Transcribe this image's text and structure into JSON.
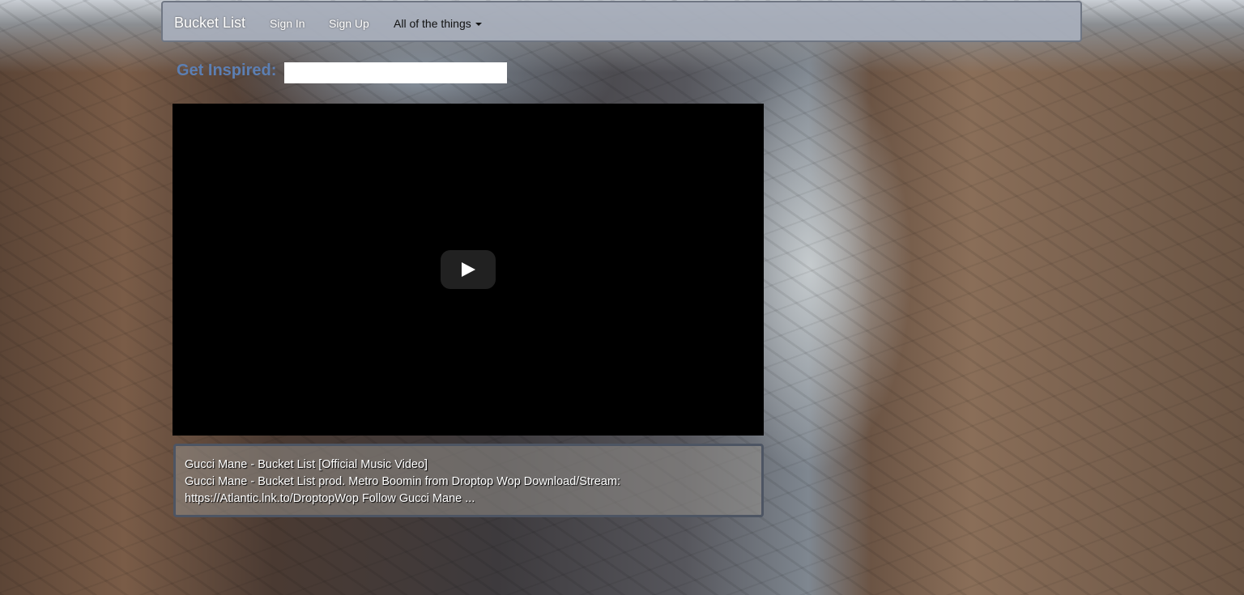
{
  "navbar": {
    "brand": "Bucket List",
    "sign_in": "Sign In",
    "sign_up": "Sign Up",
    "dropdown": "All of the things"
  },
  "search": {
    "label": "Get Inspired:",
    "value": "",
    "placeholder": ""
  },
  "video": {
    "play_icon": "play-icon"
  },
  "result": {
    "title": "Gucci Mane - Bucket List [Official Music Video]",
    "description_line1": "Gucci Mane - Bucket List prod. Metro Boomin from Droptop Wop Download/Stream:",
    "description_line2": "https://Atlantic.lnk.to/DroptopWop Follow Gucci Mane ..."
  },
  "colors": {
    "navbar_bg": "#a8aeba",
    "label_blue": "#5c7fb3",
    "video_bg": "#000000"
  }
}
